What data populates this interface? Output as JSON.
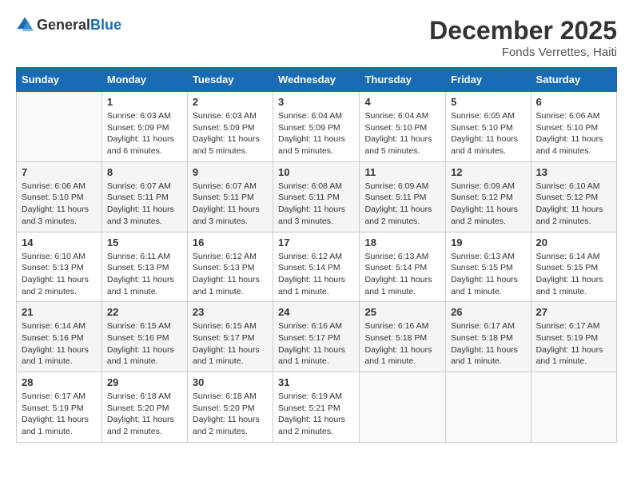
{
  "header": {
    "logo_general": "General",
    "logo_blue": "Blue",
    "month_title": "December 2025",
    "location": "Fonds Verrettes, Haiti"
  },
  "calendar": {
    "days_of_week": [
      "Sunday",
      "Monday",
      "Tuesday",
      "Wednesday",
      "Thursday",
      "Friday",
      "Saturday"
    ],
    "weeks": [
      [
        {
          "day": "",
          "sunrise": "",
          "sunset": "",
          "daylight": ""
        },
        {
          "day": "1",
          "sunrise": "Sunrise: 6:03 AM",
          "sunset": "Sunset: 5:09 PM",
          "daylight": "Daylight: 11 hours and 6 minutes."
        },
        {
          "day": "2",
          "sunrise": "Sunrise: 6:03 AM",
          "sunset": "Sunset: 5:09 PM",
          "daylight": "Daylight: 11 hours and 5 minutes."
        },
        {
          "day": "3",
          "sunrise": "Sunrise: 6:04 AM",
          "sunset": "Sunset: 5:09 PM",
          "daylight": "Daylight: 11 hours and 5 minutes."
        },
        {
          "day": "4",
          "sunrise": "Sunrise: 6:04 AM",
          "sunset": "Sunset: 5:10 PM",
          "daylight": "Daylight: 11 hours and 5 minutes."
        },
        {
          "day": "5",
          "sunrise": "Sunrise: 6:05 AM",
          "sunset": "Sunset: 5:10 PM",
          "daylight": "Daylight: 11 hours and 4 minutes."
        },
        {
          "day": "6",
          "sunrise": "Sunrise: 6:06 AM",
          "sunset": "Sunset: 5:10 PM",
          "daylight": "Daylight: 11 hours and 4 minutes."
        }
      ],
      [
        {
          "day": "7",
          "sunrise": "Sunrise: 6:06 AM",
          "sunset": "Sunset: 5:10 PM",
          "daylight": "Daylight: 11 hours and 3 minutes."
        },
        {
          "day": "8",
          "sunrise": "Sunrise: 6:07 AM",
          "sunset": "Sunset: 5:11 PM",
          "daylight": "Daylight: 11 hours and 3 minutes."
        },
        {
          "day": "9",
          "sunrise": "Sunrise: 6:07 AM",
          "sunset": "Sunset: 5:11 PM",
          "daylight": "Daylight: 11 hours and 3 minutes."
        },
        {
          "day": "10",
          "sunrise": "Sunrise: 6:08 AM",
          "sunset": "Sunset: 5:11 PM",
          "daylight": "Daylight: 11 hours and 3 minutes."
        },
        {
          "day": "11",
          "sunrise": "Sunrise: 6:09 AM",
          "sunset": "Sunset: 5:11 PM",
          "daylight": "Daylight: 11 hours and 2 minutes."
        },
        {
          "day": "12",
          "sunrise": "Sunrise: 6:09 AM",
          "sunset": "Sunset: 5:12 PM",
          "daylight": "Daylight: 11 hours and 2 minutes."
        },
        {
          "day": "13",
          "sunrise": "Sunrise: 6:10 AM",
          "sunset": "Sunset: 5:12 PM",
          "daylight": "Daylight: 11 hours and 2 minutes."
        }
      ],
      [
        {
          "day": "14",
          "sunrise": "Sunrise: 6:10 AM",
          "sunset": "Sunset: 5:13 PM",
          "daylight": "Daylight: 11 hours and 2 minutes."
        },
        {
          "day": "15",
          "sunrise": "Sunrise: 6:11 AM",
          "sunset": "Sunset: 5:13 PM",
          "daylight": "Daylight: 11 hours and 1 minute."
        },
        {
          "day": "16",
          "sunrise": "Sunrise: 6:12 AM",
          "sunset": "Sunset: 5:13 PM",
          "daylight": "Daylight: 11 hours and 1 minute."
        },
        {
          "day": "17",
          "sunrise": "Sunrise: 6:12 AM",
          "sunset": "Sunset: 5:14 PM",
          "daylight": "Daylight: 11 hours and 1 minute."
        },
        {
          "day": "18",
          "sunrise": "Sunrise: 6:13 AM",
          "sunset": "Sunset: 5:14 PM",
          "daylight": "Daylight: 11 hours and 1 minute."
        },
        {
          "day": "19",
          "sunrise": "Sunrise: 6:13 AM",
          "sunset": "Sunset: 5:15 PM",
          "daylight": "Daylight: 11 hours and 1 minute."
        },
        {
          "day": "20",
          "sunrise": "Sunrise: 6:14 AM",
          "sunset": "Sunset: 5:15 PM",
          "daylight": "Daylight: 11 hours and 1 minute."
        }
      ],
      [
        {
          "day": "21",
          "sunrise": "Sunrise: 6:14 AM",
          "sunset": "Sunset: 5:16 PM",
          "daylight": "Daylight: 11 hours and 1 minute."
        },
        {
          "day": "22",
          "sunrise": "Sunrise: 6:15 AM",
          "sunset": "Sunset: 5:16 PM",
          "daylight": "Daylight: 11 hours and 1 minute."
        },
        {
          "day": "23",
          "sunrise": "Sunrise: 6:15 AM",
          "sunset": "Sunset: 5:17 PM",
          "daylight": "Daylight: 11 hours and 1 minute."
        },
        {
          "day": "24",
          "sunrise": "Sunrise: 6:16 AM",
          "sunset": "Sunset: 5:17 PM",
          "daylight": "Daylight: 11 hours and 1 minute."
        },
        {
          "day": "25",
          "sunrise": "Sunrise: 6:16 AM",
          "sunset": "Sunset: 5:18 PM",
          "daylight": "Daylight: 11 hours and 1 minute."
        },
        {
          "day": "26",
          "sunrise": "Sunrise: 6:17 AM",
          "sunset": "Sunset: 5:18 PM",
          "daylight": "Daylight: 11 hours and 1 minute."
        },
        {
          "day": "27",
          "sunrise": "Sunrise: 6:17 AM",
          "sunset": "Sunset: 5:19 PM",
          "daylight": "Daylight: 11 hours and 1 minute."
        }
      ],
      [
        {
          "day": "28",
          "sunrise": "Sunrise: 6:17 AM",
          "sunset": "Sunset: 5:19 PM",
          "daylight": "Daylight: 11 hours and 1 minute."
        },
        {
          "day": "29",
          "sunrise": "Sunrise: 6:18 AM",
          "sunset": "Sunset: 5:20 PM",
          "daylight": "Daylight: 11 hours and 2 minutes."
        },
        {
          "day": "30",
          "sunrise": "Sunrise: 6:18 AM",
          "sunset": "Sunset: 5:20 PM",
          "daylight": "Daylight: 11 hours and 2 minutes."
        },
        {
          "day": "31",
          "sunrise": "Sunrise: 6:19 AM",
          "sunset": "Sunset: 5:21 PM",
          "daylight": "Daylight: 11 hours and 2 minutes."
        },
        {
          "day": "",
          "sunrise": "",
          "sunset": "",
          "daylight": ""
        },
        {
          "day": "",
          "sunrise": "",
          "sunset": "",
          "daylight": ""
        },
        {
          "day": "",
          "sunrise": "",
          "sunset": "",
          "daylight": ""
        }
      ]
    ]
  }
}
